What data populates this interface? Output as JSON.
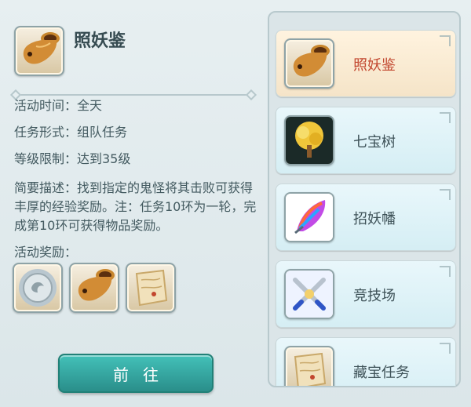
{
  "detail": {
    "title": "照妖鉴",
    "activity_time": "活动时间：全天",
    "task_form": "任务形式：组队任务",
    "level_limit": "等级限制：达到35级",
    "description": "简要描述：找到指定的鬼怪将其击败可获得丰厚的经验奖励。注：任务10环为一轮，完成第10环可获得物品奖励。",
    "reward_label": "活动奖励：",
    "rewards": [
      {
        "name": "silver-coin-icon"
      },
      {
        "name": "horn-icon"
      },
      {
        "name": "scroll-map-icon"
      }
    ],
    "go_button": "前往"
  },
  "activity_list": {
    "items": [
      {
        "label": "照妖鉴",
        "icon": "horn-icon",
        "active": true
      },
      {
        "label": "七宝树",
        "icon": "golden-tree-icon",
        "active": false
      },
      {
        "label": "招妖幡",
        "icon": "rainbow-feather-icon",
        "active": false
      },
      {
        "label": "竞技场",
        "icon": "crossed-swords-icon",
        "active": false
      },
      {
        "label": "藏宝任务",
        "icon": "scroll-map-icon",
        "active": false
      }
    ]
  },
  "colors": {
    "active_label": "#c2462e",
    "button": "#2f9c96",
    "panel_bg": "#dbe5e8"
  }
}
